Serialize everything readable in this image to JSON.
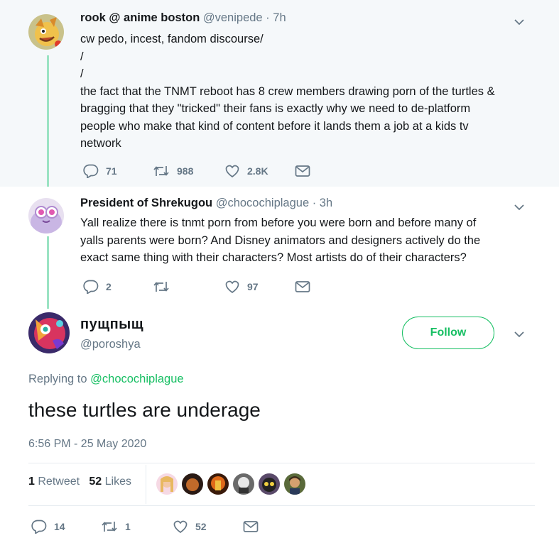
{
  "colors": {
    "accent": "#17bf63",
    "thread": "#9be3c3",
    "muted": "#657786",
    "text": "#14171a"
  },
  "tweet1": {
    "name": "rook @ anime boston",
    "handle": "@venipede · 7h",
    "lines": [
      "cw pedo, incest, fandom discourse/",
      "/",
      "/",
      "the fact that the TNMT reboot has 8 crew members drawing porn of the turtles &",
      "bragging that they \"tricked\" their fans is exactly why we need to de-platform",
      "people who make that kind of content before it lands them a job at a kids tv",
      "network"
    ],
    "replies": "71",
    "retweets": "988",
    "likes": "2.8K"
  },
  "tweet2": {
    "name": "President of Shrekugou",
    "handle": "@chocochiplague · 3h",
    "lines": [
      "Yall realize there is tnmt porn from before you were born and before many of",
      "yalls parents were born? And Disney animators and designers actively do the",
      "exact same thing with their characters? Most artists do of their characters?"
    ],
    "replies": "2",
    "retweets": "",
    "likes": "97"
  },
  "main": {
    "name": "пущпыщ",
    "handle": "@poroshya",
    "follow_label": "Follow",
    "replying_prefix": "Replying to ",
    "replying_to": "@chocochiplague",
    "text": "these turtles are underage",
    "timestamp": "6:56 PM - 25 May 2020",
    "retweet_count": "1",
    "retweet_label": "Retweet",
    "like_count": "52",
    "like_label": "Likes",
    "replies": "14",
    "retweets": "1",
    "likes": "52"
  },
  "icons": [
    "reply-icon",
    "retweet-icon",
    "like-icon",
    "dm-icon",
    "chevron-down-icon"
  ]
}
